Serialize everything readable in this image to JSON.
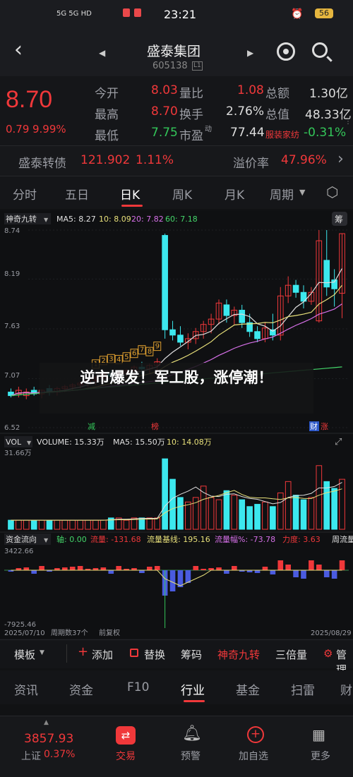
{
  "status_bar": {
    "network": "5G 5G HD",
    "time": "23:21",
    "battery": "56"
  },
  "header": {
    "title": "盛泰集团",
    "code": "605138",
    "code_badge": "L1"
  },
  "quote": {
    "price": "8.70",
    "change": "0.79",
    "change_pct": "9.99%",
    "open_label": "今开",
    "open": "8.03",
    "high_label": "最高",
    "high": "8.70",
    "low_label": "最低",
    "low": "7.75",
    "vol_ratio_label": "量比",
    "vol_ratio": "1.08",
    "turnover_label": "换手",
    "turnover": "2.76%",
    "pe_label": "市盈",
    "pe_sup": "动",
    "pe": "77.44",
    "amount_label": "总额",
    "amount": "1.30亿",
    "mcap_label": "总值",
    "mcap": "48.33亿",
    "sector": "服装家纺",
    "sector_pct": "-0.31%"
  },
  "bond": {
    "name": "盛泰转债",
    "price": "121.902",
    "pct": "1.11%",
    "premium_label": "溢价率",
    "premium": "47.96%"
  },
  "period_tabs": [
    "分时",
    "五日",
    "日K",
    "周K",
    "月K",
    "周期"
  ],
  "active_tab": "日K",
  "indicator_bar": {
    "name": "神奇九转",
    "ma5": "MA5: 8.27",
    "ma10": "10: 8.09",
    "ma20": "20: 7.82",
    "ma60": "60: 7.18",
    "chip": "筹"
  },
  "price_axis": [
    "8.74",
    "8.19",
    "7.63",
    "7.07",
    "6.52"
  ],
  "chart_tags": {
    "reduce": "减",
    "rank": "榜",
    "finance": "财",
    "limit": "涨"
  },
  "overlay_text": "逆市爆发！军工股，涨停潮！",
  "volume_bar": {
    "name": "VOL",
    "vol": "VOLUME: 15.33万",
    "ma5": "MA5: 15.50万",
    "ma10": "10: 14.08万",
    "max": "31.66万"
  },
  "flow_bar": {
    "name": "资金流向",
    "axis": "轴: 0.00",
    "flow": "流量: -131.68",
    "base": "流量基线: 195.16",
    "amp": "流量幅%: -73.78",
    "force": "力度: 3.63",
    "flow2": "周流量",
    "max": "3422.66",
    "min": "-7925.46"
  },
  "date_bar": {
    "start": "2025/07/10",
    "cycles": "周期数37个",
    "mode": "前复权",
    "end": "2025/08/29"
  },
  "toolbar": {
    "template": "模板",
    "add": "添加",
    "replace": "替换",
    "chip": "筹码",
    "nine": "神奇九转",
    "triple": "三倍量",
    "manage": "管理"
  },
  "sub_tabs": [
    "资讯",
    "资金",
    "F10",
    "行业",
    "基金",
    "扫雷",
    "财"
  ],
  "active_sub_tab": "行业",
  "bottom_nav": {
    "index_value": "3857.93",
    "index_name": "上证",
    "index_pct": "0.37%",
    "trade": "交易",
    "alert": "预警",
    "add_watch": "加自选",
    "more": "更多"
  },
  "colors": {
    "up": "#f0383a",
    "down": "#3ce8ee",
    "flat": "#33c659",
    "accent": "#f0383a",
    "bg": "#0f1012"
  },
  "chart_data": {
    "type": "candlestick",
    "price_range": [
      6.52,
      8.74
    ],
    "candles": [
      {
        "o": 6.92,
        "h": 6.96,
        "l": 6.86,
        "c": 6.88
      },
      {
        "o": 6.9,
        "h": 6.98,
        "l": 6.86,
        "c": 6.94
      },
      {
        "o": 6.88,
        "h": 6.96,
        "l": 6.84,
        "c": 6.92
      },
      {
        "o": 6.94,
        "h": 6.98,
        "l": 6.88,
        "c": 6.9
      },
      {
        "o": 6.9,
        "h": 6.95,
        "l": 6.85,
        "c": 6.94
      },
      {
        "o": 6.96,
        "h": 7.0,
        "l": 6.88,
        "c": 6.92
      },
      {
        "o": 6.92,
        "h": 6.98,
        "l": 6.88,
        "c": 6.96
      },
      {
        "o": 6.96,
        "h": 7.0,
        "l": 6.92,
        "c": 6.98
      },
      {
        "o": 6.98,
        "h": 7.02,
        "l": 6.94,
        "c": 7.0
      },
      {
        "o": 7.0,
        "h": 7.04,
        "l": 6.96,
        "c": 7.02
      },
      {
        "o": 7.02,
        "h": 7.06,
        "l": 6.98,
        "c": 7.05
      },
      {
        "o": 7.05,
        "h": 7.1,
        "l": 7.0,
        "c": 7.08
      },
      {
        "o": 7.08,
        "h": 7.14,
        "l": 7.04,
        "c": 7.12
      },
      {
        "o": 7.12,
        "h": 7.16,
        "l": 7.06,
        "c": 7.1
      },
      {
        "o": 7.1,
        "h": 7.15,
        "l": 7.06,
        "c": 7.13
      },
      {
        "o": 7.13,
        "h": 7.18,
        "l": 7.08,
        "c": 7.16
      },
      {
        "o": 7.16,
        "h": 7.22,
        "l": 7.1,
        "c": 7.2
      },
      {
        "o": 7.2,
        "h": 7.26,
        "l": 7.12,
        "c": 7.18
      },
      {
        "o": 7.18,
        "h": 7.24,
        "l": 7.12,
        "c": 7.22
      },
      {
        "o": 7.22,
        "h": 7.3,
        "l": 7.16,
        "c": 7.26
      },
      {
        "o": 8.68,
        "h": 8.7,
        "l": 7.52,
        "c": 7.62
      },
      {
        "o": 7.62,
        "h": 7.72,
        "l": 7.5,
        "c": 7.56
      },
      {
        "o": 7.56,
        "h": 7.66,
        "l": 7.44,
        "c": 7.48
      },
      {
        "o": 7.48,
        "h": 7.58,
        "l": 7.4,
        "c": 7.52
      },
      {
        "o": 7.52,
        "h": 7.64,
        "l": 7.46,
        "c": 7.6
      },
      {
        "o": 7.6,
        "h": 7.72,
        "l": 7.52,
        "c": 7.68
      },
      {
        "o": 7.68,
        "h": 7.8,
        "l": 7.58,
        "c": 7.74
      },
      {
        "o": 7.74,
        "h": 7.96,
        "l": 7.68,
        "c": 7.92
      },
      {
        "o": 7.9,
        "h": 7.96,
        "l": 7.7,
        "c": 7.78
      },
      {
        "o": 7.78,
        "h": 7.88,
        "l": 7.68,
        "c": 7.84
      },
      {
        "o": 7.84,
        "h": 7.9,
        "l": 7.64,
        "c": 7.7
      },
      {
        "o": 7.7,
        "h": 7.8,
        "l": 7.54,
        "c": 7.6
      },
      {
        "o": 7.6,
        "h": 7.66,
        "l": 7.48,
        "c": 7.52
      },
      {
        "o": 7.52,
        "h": 7.7,
        "l": 7.48,
        "c": 7.64
      },
      {
        "o": 7.62,
        "h": 7.8,
        "l": 7.5,
        "c": 7.56
      },
      {
        "o": 7.56,
        "h": 8.1,
        "l": 7.5,
        "c": 8.0
      },
      {
        "o": 8.0,
        "h": 8.22,
        "l": 7.92,
        "c": 8.12
      },
      {
        "o": 8.12,
        "h": 8.18,
        "l": 7.98,
        "c": 8.04
      },
      {
        "o": 8.04,
        "h": 8.12,
        "l": 7.86,
        "c": 7.94
      },
      {
        "o": 7.94,
        "h": 8.1,
        "l": 7.9,
        "c": 8.04
      },
      {
        "o": 7.72,
        "h": 8.74,
        "l": 7.7,
        "c": 8.62
      },
      {
        "o": 8.4,
        "h": 8.74,
        "l": 8.0,
        "c": 8.1
      },
      {
        "o": 8.18,
        "h": 8.3,
        "l": 7.88,
        "c": 8.08
      },
      {
        "o": 8.03,
        "h": 8.7,
        "l": 7.75,
        "c": 8.7
      }
    ],
    "volumes": [
      4,
      4,
      4,
      4,
      4,
      4,
      4,
      4,
      4,
      4,
      4,
      4,
      4,
      5,
      5,
      4,
      5,
      5,
      5,
      5,
      31,
      22,
      14,
      12,
      14,
      19,
      14,
      13,
      17,
      15,
      13,
      10,
      11,
      12,
      10,
      16,
      21,
      15,
      13,
      14,
      28,
      21,
      18,
      22
    ],
    "nine_turn_labels": [
      "1",
      "2",
      "3",
      "4",
      "5",
      "6",
      "7",
      "8",
      "9"
    ]
  }
}
